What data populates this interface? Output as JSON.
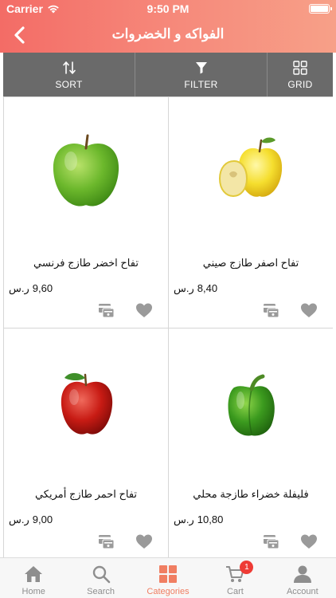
{
  "status_bar": {
    "carrier": "Carrier",
    "time": "9:50 PM"
  },
  "header": {
    "title": "الفواكه و الخضروات"
  },
  "toolbar": {
    "sort_label": "SORT",
    "filter_label": "FILTER",
    "grid_label": "GRID"
  },
  "products": [
    {
      "name": "تفاح اخضر طازج فرنسي",
      "price": "9,60",
      "currency": "ر.س",
      "image": "green-apple"
    },
    {
      "name": "تفاح اصفر طازج صيني",
      "price": "8,40",
      "currency": "ر.س",
      "image": "yellow-apple"
    },
    {
      "name": "تفاح احمر طازج أمريكي",
      "price": "9,00",
      "currency": "ر.س",
      "image": "red-apple"
    },
    {
      "name": "فليفلة خضراء طازجة محلي",
      "price": "10,80",
      "currency": "ر.س",
      "image": "green-pepper"
    }
  ],
  "tabbar": {
    "home": "Home",
    "search": "Search",
    "categories": "Categories",
    "cart": "Cart",
    "account": "Account",
    "cart_badge": "1",
    "active": "categories"
  },
  "colors": {
    "header_gradient_start": "#f36c66",
    "header_gradient_end": "#f7a088",
    "toolbar": "#6a6a6a",
    "active_tab": "#f07e62",
    "badge": "#ee3b35"
  }
}
